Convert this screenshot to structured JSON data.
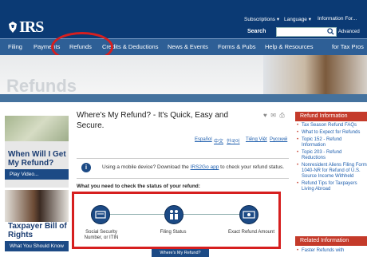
{
  "header": {
    "logo": "IRS",
    "utility": [
      "Subscriptions ▾",
      "Language ▾",
      "Information For..."
    ],
    "search_label": "Search",
    "advanced": "Advanced"
  },
  "nav": [
    "Filing",
    "Payments",
    "Refunds",
    "Credits & Deductions",
    "News & Events",
    "Forms & Pubs",
    "Help & Resources",
    "for Tax Pros"
  ],
  "banner": {
    "title": "Refunds"
  },
  "left": {
    "promo1_title": "When Will I Get My Refund?",
    "promo1_button": "Play Video...",
    "promo2_title": "Taxpayer Bill of Rights",
    "promo2_button": "What You Should Know"
  },
  "main": {
    "title": "Where's My Refund? - It's Quick, Easy and Secure.",
    "languages": [
      "Español",
      "中文",
      "한국어",
      "Tiếng Việt",
      "Русский"
    ],
    "mobile_prefix": "Using a mobile device? Download the ",
    "mobile_link": "IRS2Go app",
    "mobile_suffix": " to check your refund status.",
    "need_text": "What you need to check the status of your refund:",
    "steps": [
      "Social Security Number, or ITIN",
      "Filing Status",
      "Exact Refund Amount"
    ],
    "button": "Where's My Refund?"
  },
  "right": {
    "refund_info_title": "Refund Information",
    "refund_info_items": [
      "Tax Season Refund FAQs",
      "What to Expect for Refunds",
      "Topic 152 - Refund Information",
      "Topic 203 - Refund Reductions",
      "Nonresident Aliens Filing Form 1040-NR for Refund of U.S. Source Income Withheld",
      "Refund Tips for Taxpayers Living Abroad"
    ],
    "related_title": "Related Information",
    "related_items": [
      "Faster Refunds with"
    ]
  },
  "colors": {
    "header": "#0b3a74",
    "nav": "#2e5f96",
    "highlight": "#d61f1f",
    "sidebar_head": "#c43a2a"
  }
}
